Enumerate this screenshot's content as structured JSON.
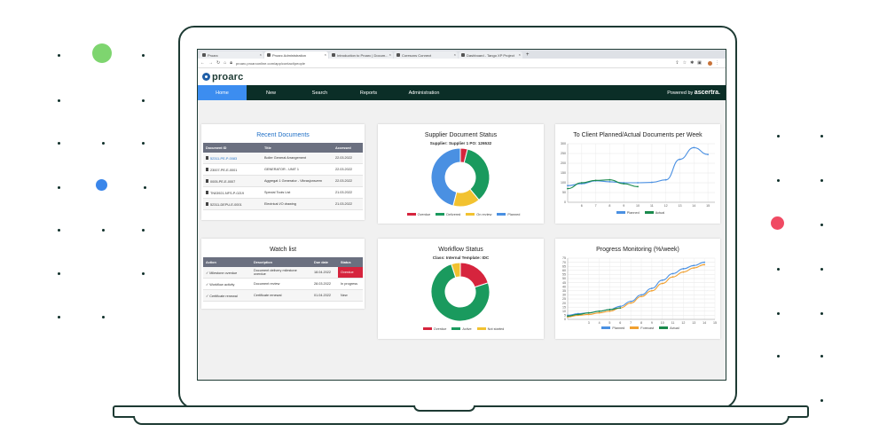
{
  "colors": {
    "dark": "#0b2e27",
    "accent": "#3c8df0",
    "overdue": "#d6243d",
    "delivered": "#1a9a5e",
    "onreview": "#f2c230",
    "planned": "#4a90e2",
    "green_dot": "#7ed56f",
    "blue_dot": "#3a86ea",
    "red_dot": "#f04a63"
  },
  "browser": {
    "tabs": [
      "Proarc",
      "Proarc Administration",
      "Introduction to Proarc | Docum...",
      "Coresons Connect",
      "Dashboard - Tango XP Project"
    ],
    "url": "proarc.proarconline.com/app/contact/people"
  },
  "app": {
    "logo": "proarc",
    "menu": [
      "Home",
      "New",
      "Search",
      "Reports",
      "Administration"
    ],
    "powered_prefix": "Powered by",
    "powered_brand": "ascertra."
  },
  "recent": {
    "title": "Recent Documents",
    "headers": [
      "Document ID",
      "Title",
      "Accessed"
    ],
    "rows": [
      [
        "52311-PE-P-0083",
        "Boiler General Arrangement",
        "22.03.2022"
      ],
      [
        "23007-PE-E-0001",
        "GENERATOR - UNIT 1",
        "22.03.2022"
      ],
      [
        "0005-PE-E-0007",
        "Aggregat 1 Generator - Vibrasjonsvern",
        "22.03.2022"
      ],
      [
        "TN03921-NFS-P-0219",
        "Special Tools List",
        "21.03.2022"
      ],
      [
        "52311-DEPU-E-0001",
        "Electrical I/O drawing",
        "21.03.2022"
      ]
    ]
  },
  "supplier": {
    "title": "Supplier Document Status",
    "subtitle": "Supplier: Supplier 1   PO: 126532",
    "legend": [
      "Overdue",
      "Delivered",
      "On review",
      "Planned"
    ]
  },
  "client": {
    "title": "To Client Planned/Actual Documents per Week",
    "legend": [
      "Planned",
      "Actual"
    ]
  },
  "watch": {
    "title": "Watch list",
    "headers": [
      "Action",
      "Description",
      "Due date",
      "Status"
    ],
    "rows": [
      [
        "Milestone overdue",
        "Document delivery milestone overdue",
        "18.04.2022",
        "Overdue"
      ],
      [
        "Workflow activity",
        "Document review",
        "28.03.2022",
        "In progress"
      ],
      [
        "Certificate renewal",
        "Certificate renewal",
        "01.04.2022",
        "New"
      ]
    ]
  },
  "workflow": {
    "title": "Workflow Status",
    "subtitle": "Class: Internal   Template: IDC",
    "legend": [
      "Overdue",
      "Active",
      "Not started"
    ]
  },
  "progress": {
    "title": "Progress Monitoring (%/week)",
    "legend": [
      "Planned",
      "Forecast",
      "Actual"
    ]
  },
  "chart_data": [
    {
      "type": "pie",
      "title": "Supplier Document Status",
      "labels": [
        "Overdue",
        "Delivered",
        "On review",
        "Planned"
      ],
      "values": [
        4,
        35,
        15,
        46
      ],
      "colors": [
        "#d6243d",
        "#1a9a5e",
        "#f2c230",
        "#4a90e2"
      ]
    },
    {
      "type": "line",
      "title": "To Client Planned/Actual Documents per Week",
      "x": [
        6,
        7,
        8,
        9,
        10,
        11,
        12,
        13,
        14,
        15
      ],
      "ylim": [
        0,
        300
      ],
      "yticks": [
        0,
        50,
        100,
        150,
        200,
        250,
        300
      ],
      "series": [
        {
          "name": "Planned",
          "color": "#4a90e2",
          "points": [
            [
              5,
              85
            ],
            [
              6,
              95
            ],
            [
              7,
              110
            ],
            [
              8,
              105
            ],
            [
              9,
              100
            ],
            [
              10,
              100
            ],
            [
              11,
              102
            ],
            [
              12,
              115
            ],
            [
              13,
              220
            ],
            [
              14,
              280
            ],
            [
              15,
              245
            ]
          ]
        },
        {
          "name": "Actual",
          "color": "#1a8a4c",
          "points": [
            [
              5,
              70
            ],
            [
              6,
              100
            ],
            [
              7,
              112
            ],
            [
              8,
              115
            ],
            [
              9,
              95
            ],
            [
              10,
              80
            ]
          ]
        }
      ]
    },
    {
      "type": "pie",
      "title": "Workflow Status",
      "labels": [
        "Overdue",
        "Active",
        "Not started"
      ],
      "values": [
        20,
        75,
        5
      ],
      "colors": [
        "#d6243d",
        "#1a9a5e",
        "#f2c230"
      ]
    },
    {
      "type": "line",
      "title": "Progress Monitoring (%/week)",
      "x": [
        3,
        4,
        5,
        6,
        7,
        8,
        9,
        10,
        11,
        12,
        13,
        14,
        15
      ],
      "ylim": [
        0,
        75
      ],
      "yticks": [
        0,
        5,
        10,
        15,
        20,
        25,
        30,
        35,
        40,
        45,
        50,
        55,
        60,
        65,
        70,
        75
      ],
      "series": [
        {
          "name": "Planned",
          "color": "#4a90e2",
          "points": [
            [
              1,
              5
            ],
            [
              2,
              7
            ],
            [
              3,
              8
            ],
            [
              4,
              10
            ],
            [
              5,
              12
            ],
            [
              6,
              16
            ],
            [
              7,
              22
            ],
            [
              8,
              30
            ],
            [
              9,
              38
            ],
            [
              10,
              48
            ],
            [
              11,
              56
            ],
            [
              12,
              62
            ],
            [
              13,
              66
            ],
            [
              14,
              70
            ]
          ]
        },
        {
          "name": "Forecast",
          "color": "#f0a030",
          "points": [
            [
              1,
              3
            ],
            [
              2,
              5
            ],
            [
              3,
              6
            ],
            [
              4,
              8
            ],
            [
              5,
              10
            ],
            [
              6,
              14
            ],
            [
              7,
              20
            ],
            [
              8,
              28
            ],
            [
              9,
              35
            ],
            [
              10,
              44
            ],
            [
              11,
              52
            ],
            [
              12,
              58
            ],
            [
              13,
              63
            ],
            [
              14,
              67
            ]
          ]
        },
        {
          "name": "Actual",
          "color": "#1a8a4c",
          "points": [
            [
              1,
              4
            ],
            [
              2,
              6
            ],
            [
              3,
              8
            ],
            [
              4,
              10
            ],
            [
              5,
              12
            ],
            [
              6,
              14
            ]
          ]
        }
      ]
    }
  ]
}
